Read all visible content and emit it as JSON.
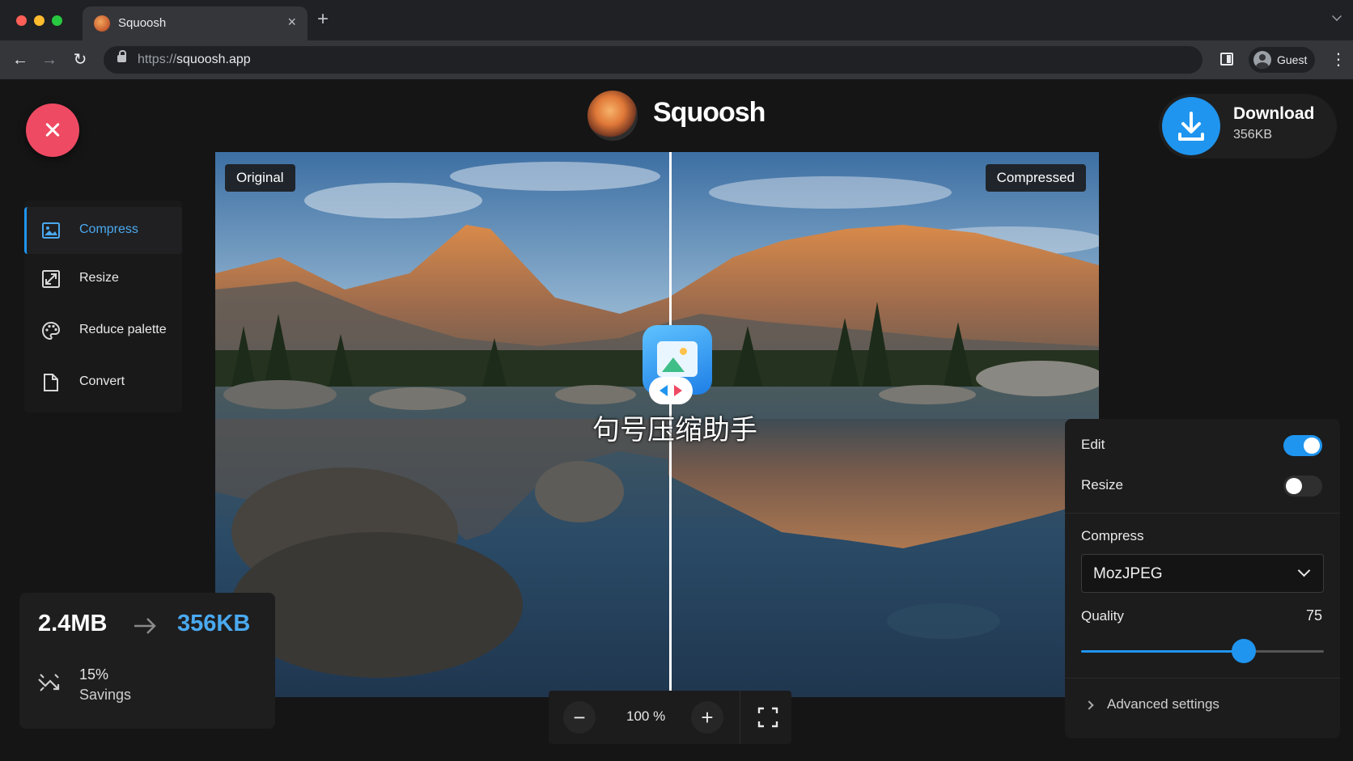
{
  "browser": {
    "tab_title": "Squoosh",
    "new_tab": "+",
    "tab_close": "×",
    "url_scheme": "https://",
    "url_host": "squoosh.app",
    "profile_label": "Guest",
    "menu": "⋮",
    "back": "←",
    "forward": "→",
    "reload": "↻"
  },
  "header": {
    "brand": "Squoosh",
    "download_label": "Download",
    "download_size": "356KB"
  },
  "viewer": {
    "left_label": "Original",
    "right_label": "Compressed",
    "watermark_text": "句号压缩助手"
  },
  "side_nav": {
    "items": [
      {
        "label": "Compress",
        "icon": "image-icon",
        "active": true
      },
      {
        "label": "Resize",
        "icon": "resize-icon",
        "active": false
      },
      {
        "label": "Reduce palette",
        "icon": "palette-icon",
        "active": false
      },
      {
        "label": "Convert",
        "icon": "file-icon",
        "active": false
      }
    ]
  },
  "stats": {
    "original_size": "2.4MB",
    "compressed_size": "356KB",
    "savings_percent": "15%",
    "savings_label": "Savings"
  },
  "zoom": {
    "minus": "−",
    "value": "100 %",
    "plus": "+"
  },
  "panel": {
    "edit_label": "Edit",
    "edit_on": true,
    "resize_label": "Resize",
    "resize_on": false,
    "compress_label": "Compress",
    "codec": "MozJPEG",
    "quality_label": "Quality",
    "quality_value": "75",
    "quality_fraction": 0.67,
    "advanced_label": "Advanced settings"
  },
  "colors": {
    "accent": "#1f95ef",
    "close": "#ef4a63",
    "background": "#151516"
  }
}
